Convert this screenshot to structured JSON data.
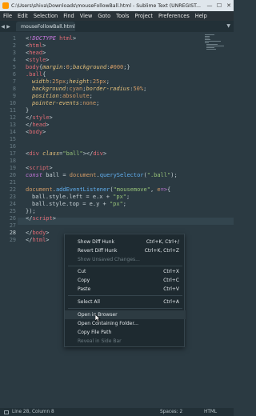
{
  "window": {
    "title": "C:\\Users\\shiva\\Downloads\\mouseFollowBall.html - Sublime Text (UNREGIST...",
    "minimize_glyph": "—",
    "maximize_glyph": "☐",
    "close_glyph": "✕"
  },
  "menubar": {
    "items": [
      "File",
      "Edit",
      "Selection",
      "Find",
      "View",
      "Goto",
      "Tools",
      "Project",
      "Preferences",
      "Help"
    ]
  },
  "tabs": {
    "back": "◀",
    "forward": "▶",
    "active_label": "mouseFollowBall.html",
    "dropdown": "▼"
  },
  "editor": {
    "line_numbers": [
      "1",
      "2",
      "3",
      "4",
      "5",
      "6",
      "7",
      "8",
      "9",
      "10",
      "11",
      "12",
      "13",
      "14",
      "15",
      "16",
      "17",
      "18",
      "19",
      "20",
      "21",
      "22",
      "23",
      "24",
      "25",
      "26",
      "27",
      "28",
      "29"
    ],
    "current_line": "28"
  },
  "context_menu": {
    "items": [
      {
        "label": "Show Diff Hunk",
        "shortcut": "Ctrl+K, Ctrl+/"
      },
      {
        "label": "Revert Diff Hunk",
        "shortcut": "Ctrl+K, Ctrl+Z"
      },
      {
        "label": "Show Unsaved Changes...",
        "shortcut": ""
      },
      {
        "label": "Cut",
        "shortcut": "Ctrl+X"
      },
      {
        "label": "Copy",
        "shortcut": "Ctrl+C"
      },
      {
        "label": "Paste",
        "shortcut": "Ctrl+V"
      },
      {
        "label": "Select All",
        "shortcut": "Ctrl+A"
      },
      {
        "label": "Open in Browser",
        "shortcut": ""
      },
      {
        "label": "Open Containing Folder...",
        "shortcut": ""
      },
      {
        "label": "Copy File Path",
        "shortcut": ""
      },
      {
        "label": "Reveal in Side Bar",
        "shortcut": ""
      }
    ]
  },
  "statusbar": {
    "position": "Line 28, Column 8",
    "indent": "Spaces: 2",
    "syntax": "HTML"
  },
  "colors": {
    "editor_bg": "#2b3a42",
    "tag": "#e06c75",
    "string": "#98c379",
    "keyword": "#c678dd",
    "function": "#61afef"
  }
}
